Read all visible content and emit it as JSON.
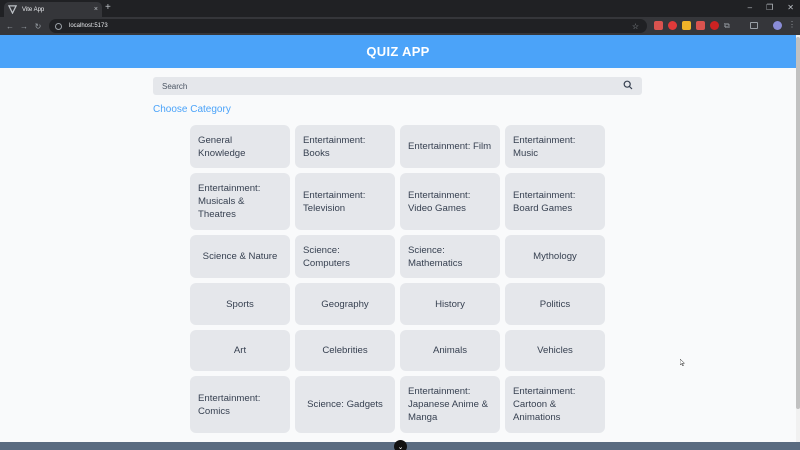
{
  "browser": {
    "tab_title": "Vite App",
    "tab_close": "×",
    "new_tab": "+",
    "window_controls": [
      "–",
      "❐",
      "✕"
    ],
    "nav": [
      "←",
      "→",
      "↻"
    ],
    "url": "localhost:5173",
    "star": "☆",
    "ext_colors": [
      "#d9534f",
      "#e03a3a",
      "#f0b429",
      "#d9534f",
      "#cc2222"
    ]
  },
  "app": {
    "title": "QUIZ APP",
    "accent": "#4ba3f9"
  },
  "search": {
    "placeholder": "Search"
  },
  "heading": "Choose Category",
  "categories": [
    {
      "label": "General Knowledge",
      "center": false
    },
    {
      "label": "Entertainment: Books",
      "center": false
    },
    {
      "label": "Entertainment: Film",
      "center": false
    },
    {
      "label": "Entertainment: Music",
      "center": false
    },
    {
      "label": "Entertainment: Musicals & Theatres",
      "center": false
    },
    {
      "label": "Entertainment: Television",
      "center": false
    },
    {
      "label": "Entertainment: Video Games",
      "center": false
    },
    {
      "label": "Entertainment: Board Games",
      "center": false
    },
    {
      "label": "Science & Nature",
      "center": true
    },
    {
      "label": "Science: Computers",
      "center": false
    },
    {
      "label": "Science: Mathematics",
      "center": false
    },
    {
      "label": "Mythology",
      "center": true
    },
    {
      "label": "Sports",
      "center": true
    },
    {
      "label": "Geography",
      "center": true
    },
    {
      "label": "History",
      "center": true
    },
    {
      "label": "Politics",
      "center": true
    },
    {
      "label": "Art",
      "center": true
    },
    {
      "label": "Celebrities",
      "center": true
    },
    {
      "label": "Animals",
      "center": true
    },
    {
      "label": "Vehicles",
      "center": true
    },
    {
      "label": "Entertainment: Comics",
      "center": false
    },
    {
      "label": "Science: Gadgets",
      "center": true
    },
    {
      "label": "Entertainment: Japanese Anime & Manga",
      "center": false
    },
    {
      "label": "Entertainment: Cartoon & Animations",
      "center": false
    }
  ],
  "footer_button": "⌄"
}
